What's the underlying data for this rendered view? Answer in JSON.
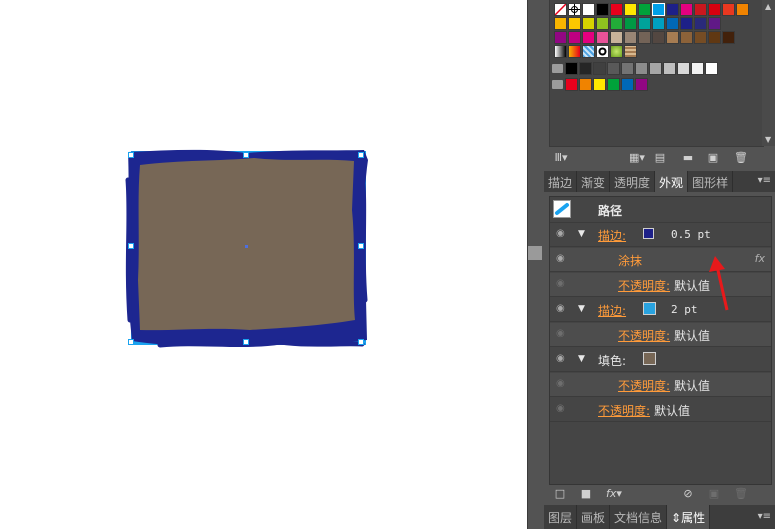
{
  "swatches": {
    "rows": [
      [
        "#ffffff",
        "#ffffff",
        "#ffffff",
        "#000000",
        "#e8001c",
        "#ffe800",
        "#00a23a",
        "#00a0e9",
        "#1d2088",
        "#e4007f",
        "#d7000f",
        "#c9171e",
        "#e83820",
        "#f08300"
      ],
      [
        "#f8b500",
        "#fcc800",
        "#d6d300",
        "#8fc31f",
        "#22ac38",
        "#009944",
        "#00a29a",
        "#00a0c1",
        "#0068b7",
        "#1d2088",
        "#601986",
        "#920783"
      ],
      [
        "#920783",
        "#be0081",
        "#e4007f",
        "#e85298",
        "#c7b299",
        "#998675",
        "#736357",
        "#534741",
        "#a67c52",
        "#8c6239",
        "#754c24",
        "#603813",
        "#42210b"
      ],
      [
        "#eeeeee",
        "#f8b500",
        "#4da3e3",
        "#ffffff",
        "#9ccf3c",
        "#a67c52"
      ],
      [
        "#000000",
        "#262626",
        "#404040",
        "#595959",
        "#737373",
        "#8c8c8c",
        "#a6a6a6",
        "#bfbfbf",
        "#d9d9d9",
        "#f2f2f2",
        "#ffffff"
      ],
      [
        "#e8001c",
        "#f08300",
        "#ffe800",
        "#00a23a",
        "#00a0e9",
        "#1d2088",
        "#920783"
      ]
    ]
  },
  "tabs_top": [
    "描边",
    "渐变",
    "透明度",
    "外观",
    "图形样"
  ],
  "tabs_bottom": [
    "图层",
    "画板",
    "文档信息",
    "属性"
  ],
  "appearance": {
    "header": "路径",
    "stroke1_label": "描边:",
    "stroke1_color": "#1d2088",
    "stroke1_value": "0.5 pt",
    "effect_label": "涂抹",
    "effect_fx": "fx",
    "opacity_label": "不透明度:",
    "opacity_value": "默认值",
    "stroke2_label": "描边:",
    "stroke2_color": "#29a3e0",
    "stroke2_value": "2 pt",
    "fill_label": "填色:",
    "fill_color": "#776756",
    "colors": {
      "selection": "#1aa3f0",
      "shape_fill": "#776756",
      "scribble": "#1d2690",
      "arrow": "#e8191b"
    }
  }
}
